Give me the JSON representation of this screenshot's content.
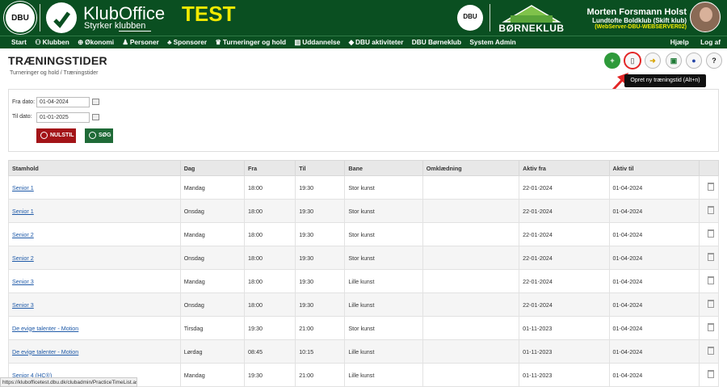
{
  "brand": {
    "dbu_logo_text": "DBU",
    "app_name": "KlubOffice",
    "tagline": "Styrker klubben",
    "env_label": "TEST",
    "partner_logo_text": "DBU",
    "partner_brand": "BØRNEKLUB"
  },
  "user": {
    "name": "Morten Forsmann Holst",
    "club": "Lundtofte Boldklub (Skift klub)",
    "server": "(WebServer-DBU-WEBSERVER02)"
  },
  "nav": {
    "items": [
      {
        "label": "Start"
      },
      {
        "label": "Klubben",
        "icon": "people-icon"
      },
      {
        "label": "Økonomi",
        "icon": "money-icon"
      },
      {
        "label": "Personer",
        "icon": "person-icon"
      },
      {
        "label": "Sponsorer",
        "icon": "sponsor-icon"
      },
      {
        "label": "Turneringer og hold",
        "icon": "trophy-icon"
      },
      {
        "label": "Uddannelse",
        "icon": "education-icon"
      },
      {
        "label": "DBU aktiviteter",
        "icon": "cap-icon"
      },
      {
        "label": "DBU Børneklub"
      },
      {
        "label": "System Admin"
      }
    ],
    "right": [
      {
        "label": "Hjælp"
      },
      {
        "label": "Log af"
      }
    ]
  },
  "page": {
    "title": "TRÆNINGSTIDER",
    "breadcrumb": "Turneringer og hold / Træningstider"
  },
  "toolbar": {
    "tooltip": "Opret ny træningstid (Alt+n)"
  },
  "filter": {
    "from_label": "Fra dato:",
    "from_value": "01-04-2024",
    "to_label": "Til dato:",
    "to_value": "01-01-2025",
    "reset_label": "NULSTIL",
    "search_label": "SØG"
  },
  "table": {
    "headers": [
      "Stamhold",
      "Dag",
      "Fra",
      "Til",
      "Bane",
      "Omklædning",
      "Aktiv fra",
      "Aktiv til"
    ],
    "rows": [
      [
        "Senior 1",
        "Mandag",
        "18:00",
        "19:30",
        "Stor kunst",
        "",
        "22-01-2024",
        "01-04-2024"
      ],
      [
        "Senior 1",
        "Onsdag",
        "18:00",
        "19:30",
        "Stor kunst",
        "",
        "22-01-2024",
        "01-04-2024"
      ],
      [
        "Senior 2",
        "Mandag",
        "18:00",
        "19:30",
        "Stor kunst",
        "",
        "22-01-2024",
        "01-04-2024"
      ],
      [
        "Senior 2",
        "Onsdag",
        "18:00",
        "19:30",
        "Stor kunst",
        "",
        "22-01-2024",
        "01-04-2024"
      ],
      [
        "Senior 3",
        "Mandag",
        "18:00",
        "19:30",
        "Lille kunst",
        "",
        "22-01-2024",
        "01-04-2024"
      ],
      [
        "Senior 3",
        "Onsdag",
        "18:00",
        "19:30",
        "Lille kunst",
        "",
        "22-01-2024",
        "01-04-2024"
      ],
      [
        "De evige talenter - Motion",
        "Tirsdag",
        "19:30",
        "21:00",
        "Stor kunst",
        "",
        "01-11-2023",
        "01-04-2024"
      ],
      [
        "De evige talenter - Motion",
        "Lørdag",
        "08:45",
        "10:15",
        "Lille kunst",
        "",
        "01-11-2023",
        "01-04-2024"
      ],
      [
        "Senior 4 (HC®)",
        "Mandag",
        "19:30",
        "21:00",
        "Lille kunst",
        "",
        "01-11-2023",
        "01-04-2024"
      ]
    ]
  },
  "status_bar": {
    "url": "https://klubofficetest.dbu.dk/clubadmin/PracticeTimeList.aspx#"
  },
  "colors": {
    "header_bg": "#0a4f21",
    "env_label": "#f2ea00",
    "reset_button": "#a31418",
    "search_button": "#1f6a37",
    "link": "#1f5aa8",
    "highlight": "#e32626"
  }
}
